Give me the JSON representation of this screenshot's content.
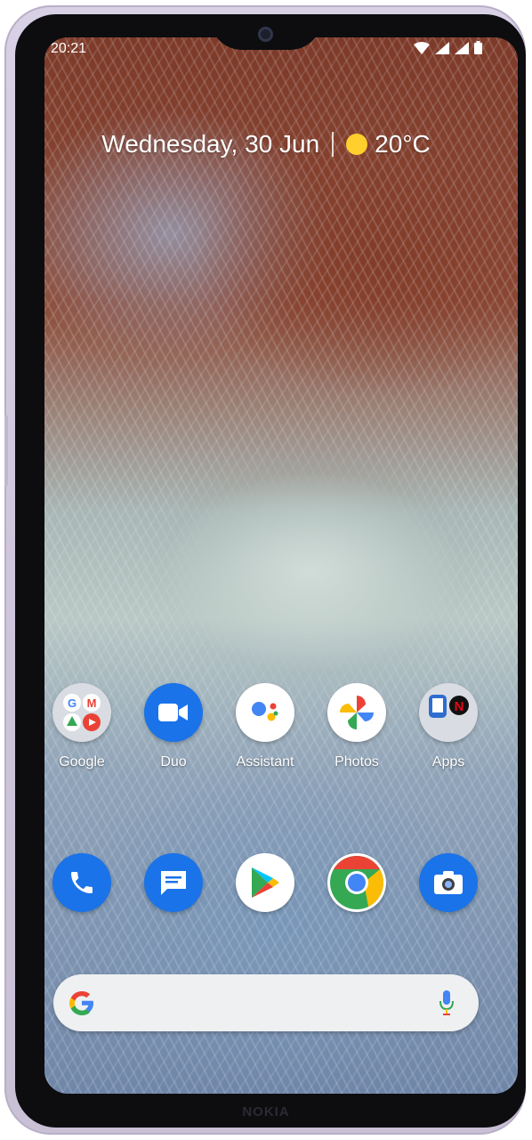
{
  "status_bar": {
    "time": "20:21"
  },
  "at_a_glance": {
    "date": "Wednesday, 30 Jun",
    "temperature": "20°C",
    "weather_icon": "sun-icon"
  },
  "home_row": [
    {
      "label": "Google",
      "icon": "google-folder-icon"
    },
    {
      "label": "Duo",
      "icon": "duo-icon"
    },
    {
      "label": "Assistant",
      "icon": "assistant-icon"
    },
    {
      "label": "Photos",
      "icon": "photos-icon"
    },
    {
      "label": "Apps",
      "icon": "apps-folder-icon"
    }
  ],
  "dock": [
    {
      "icon": "phone-icon"
    },
    {
      "icon": "messages-icon"
    },
    {
      "icon": "play-store-icon"
    },
    {
      "icon": "chrome-icon"
    },
    {
      "icon": "camera-icon"
    }
  ],
  "search_bar": {
    "icon": "google-g-icon",
    "mic": "mic-icon"
  },
  "device": {
    "brand": "NOKIA"
  },
  "colors": {
    "google_blue": "#4285F4",
    "google_red": "#EA4335",
    "google_yellow": "#FBBC05",
    "google_green": "#34A853"
  }
}
